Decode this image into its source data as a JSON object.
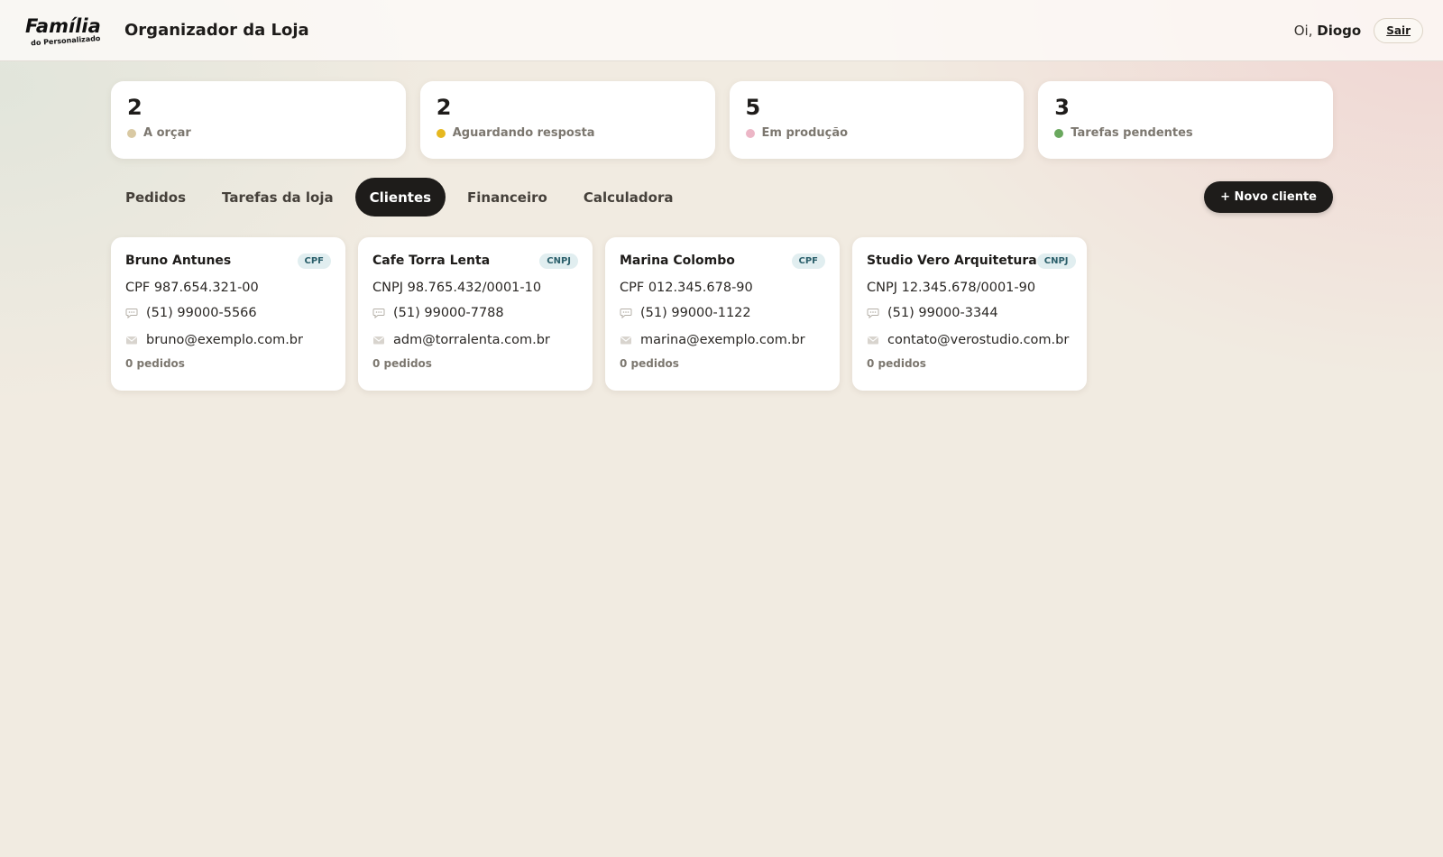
{
  "header": {
    "app_title": "Organizador da Loja",
    "greeting_prefix": "Oi,",
    "user_name": "Diogo",
    "logout_label": "Sair"
  },
  "stats": [
    {
      "value": "2",
      "label": "A orçar",
      "color": "#d9c9a3"
    },
    {
      "value": "2",
      "label": "Aguardando resposta",
      "color": "#e6b820"
    },
    {
      "value": "5",
      "label": "Em produção",
      "color": "#ecb6c6"
    },
    {
      "value": "3",
      "label": "Tarefas pendentes",
      "color": "#6aa85e"
    }
  ],
  "tabs": [
    {
      "label": "Pedidos",
      "active": false
    },
    {
      "label": "Tarefas da loja",
      "active": false
    },
    {
      "label": "Clientes",
      "active": true
    },
    {
      "label": "Financeiro",
      "active": false
    },
    {
      "label": "Calculadora",
      "active": false
    }
  ],
  "new_client_label": "+ Novo cliente",
  "clients": [
    {
      "name": "Bruno Antunes",
      "type": "CPF",
      "document": "CPF 987.654.321-00",
      "phone": "(51) 99000-5566",
      "email": "bruno@exemplo.com.br",
      "orders": "0 pedidos"
    },
    {
      "name": "Cafe Torra Lenta",
      "type": "CNPJ",
      "document": "CNPJ 98.765.432/0001-10",
      "phone": "(51) 99000-7788",
      "email": "adm@torralenta.com.br",
      "orders": "0 pedidos"
    },
    {
      "name": "Marina Colombo",
      "type": "CPF",
      "document": "CPF 012.345.678-90",
      "phone": "(51) 99000-1122",
      "email": "marina@exemplo.com.br",
      "orders": "0 pedidos"
    },
    {
      "name": "Studio Vero Arquitetura",
      "type": "CNPJ",
      "document": "CNPJ 12.345.678/0001-90",
      "phone": "(51) 99000-3344",
      "email": "contato@verostudio.com.br",
      "orders": "0 pedidos"
    }
  ],
  "icons": {
    "phone": "speech-bubble-icon",
    "email": "envelope-icon"
  }
}
